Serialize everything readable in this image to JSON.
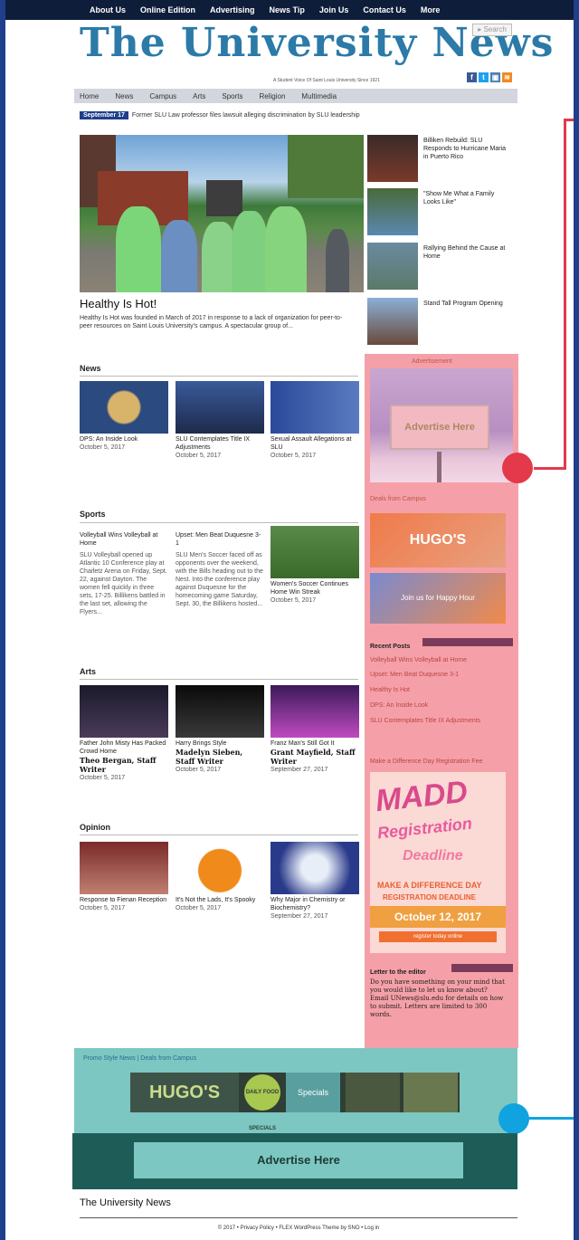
{
  "top_nav": [
    "About Us",
    "Online Edition",
    "Advertising",
    "News Tip",
    "Join Us",
    "Contact Us",
    "More"
  ],
  "masthead": {
    "title": "The University News",
    "tagline": "A Student Voice Of Saint Louis University Since 1921",
    "search_label": "Search",
    "socials": [
      {
        "name": "facebook-icon",
        "glyph": "f",
        "color": "#3b5998"
      },
      {
        "name": "twitter-icon",
        "glyph": "t",
        "color": "#1da1f2"
      },
      {
        "name": "instagram-icon",
        "glyph": "i",
        "color": "#4a7fb0"
      },
      {
        "name": "rss-icon",
        "glyph": "r",
        "color": "#f08a24"
      }
    ]
  },
  "main_nav": [
    "Home",
    "News",
    "Campus",
    "Arts",
    "Sports",
    "Religion",
    "Multimedia"
  ],
  "ticker": {
    "date": "September 17",
    "text": "Former SLU Law professor files lawsuit alleging discrimination by SLU leadership"
  },
  "hero": {
    "title": "Healthy Is Hot!",
    "excerpt": "Healthy Is Hot was founded in March of 2017 in response to a lack of organization for peer-to-peer resources on Saint Louis University's campus. A spectacular group of..."
  },
  "side_items": [
    {
      "caption": "Billiken Rebuild: SLU Responds to Hurricane Maria in Puerto Rico"
    },
    {
      "caption": "\"Show Me What a Family Looks Like\""
    },
    {
      "caption": "Rallying Behind the Cause at Home"
    },
    {
      "caption": "Stand Tall Program Opening"
    }
  ],
  "sections": {
    "news": {
      "heading": "News",
      "cards": [
        {
          "title": "DPS: An Inside Look",
          "date": "October 5, 2017"
        },
        {
          "title": "SLU Contemplates Title IX Adjustments",
          "date": "October 5, 2017"
        },
        {
          "title": "Sexual Assault Allegations at SLU",
          "date": "October 5, 2017"
        }
      ]
    },
    "sports": {
      "heading": "Sports",
      "col1_title": "Volleyball Wins Volleyball at Home",
      "col1_text": "SLU Volleyball opened up Atlantic 10 Conference play at Chaifetz Arena on Friday, Sept. 22, against Dayton. The women fell quickly in three sets, 17-25. Billikens battled in the last set, allowing the Flyers...",
      "col2_title": "Upset: Men Beat Duquesne 3-1",
      "col2_text": "SLU Men's Soccer faced off as opponents over the weekend, with the Bills heading out to the Nest. Into the conference play against Duquesne for the homecoming game Saturday, Sept. 30, the Billikens hosted...",
      "col3_title": "Women's Soccer Continues Home Win Streak",
      "col3_date": "October 5, 2017"
    },
    "arts": {
      "heading": "Arts",
      "cards": [
        {
          "title": "Father John Misty Has Packed Crowd Home",
          "byline": "Theo Bergan, Staff Writer",
          "date": "October 5, 2017"
        },
        {
          "title": "Harry Brings Style",
          "byline": "Madelyn Sieben, Staff Writer",
          "date": "October 5, 2017"
        },
        {
          "title": "Franz Man's Still Got It",
          "byline": "Grant Mayfield, Staff Writer",
          "date": "September 27, 2017"
        }
      ]
    },
    "opinion": {
      "heading": "Opinion",
      "cards": [
        {
          "title": "Response to Fienan Reception",
          "date": "October 5, 2017"
        },
        {
          "title": "It's Not the Lads, It's Spooky",
          "date": "October 5, 2017"
        },
        {
          "title": "Why Major in Chemistry or Biochemistry?",
          "date": "September 27, 2017"
        }
      ]
    }
  },
  "sidebar": {
    "ad_label": "Advertisement",
    "ad_text": "Advertise Here",
    "deals_label": "Deals from Campus",
    "hugo_label": "HUGO'S",
    "hugo_sub": "Join us for Happy Hour",
    "recent_posts_heading": "Recent Posts",
    "recent_posts": [
      "Volleyball Wins Volleyball at Home",
      "Upset: Men Beat Duquesne 3-1",
      "Healthy Is Hot",
      "DPS: An Inside Look",
      "SLU Contemplates Title IX Adjustments"
    ],
    "madd_label": "Make a Difference Day Registration Fee",
    "madd": {
      "line1": "MADD",
      "line2": "Registration",
      "line3": "Deadline",
      "line4": "MAKE A DIFFERENCE DAY",
      "line5": "REGISTRATION DEADLINE",
      "line6": "October 12, 2017",
      "line7": "register today online"
    },
    "letter_heading": "Letter to the editor",
    "letter_text": "Do you have something on your mind that you would like to let us know about? Email UNews@slu.edu for details on how to submit. Letters are limited to 300 words."
  },
  "footer_ad": {
    "label": "Promo Style News | Deals from Campus",
    "hugo": "HUGO'S",
    "badge": "DAILY FOOD SPECIALS",
    "specials": "Specials",
    "button": "Advertise Here"
  },
  "footer": {
    "title": "The University News",
    "copyright": "© 2017 • Privacy Policy • FLEX WordPress Theme by SNO • Log in"
  }
}
